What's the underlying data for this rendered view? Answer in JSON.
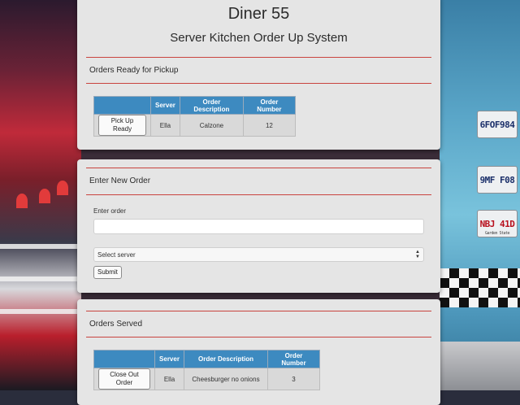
{
  "app": {
    "title": "Diner 55",
    "subtitle": "Server Kitchen Order Up System"
  },
  "pickup": {
    "heading": "Orders Ready for Pickup",
    "columns": [
      "",
      "Server",
      "Order Description",
      "Order Number"
    ],
    "rows": [
      {
        "action": "Pick Up Ready",
        "server": "Ella",
        "description": "Calzone",
        "number": "12"
      }
    ]
  },
  "new_order": {
    "heading": "Enter New Order",
    "order_label": "Enter order",
    "order_value": "",
    "server_select": "Select server",
    "submit_label": "Submit"
  },
  "served": {
    "heading": "Orders Served",
    "columns": [
      "",
      "Server",
      "Order Description",
      "Order Number"
    ],
    "rows": [
      {
        "action": "Close Out Order",
        "server": "Ella",
        "description": "Cheesburger no onions",
        "number": "3"
      }
    ]
  },
  "background": {
    "plates": [
      "6FOF984",
      "9MF F08",
      "NBJ 41D"
    ],
    "plate_caption": "Garden State"
  },
  "colors": {
    "accent": "#3d8ac0",
    "divider": "#c9443f",
    "panel": "#e5e5e5"
  }
}
